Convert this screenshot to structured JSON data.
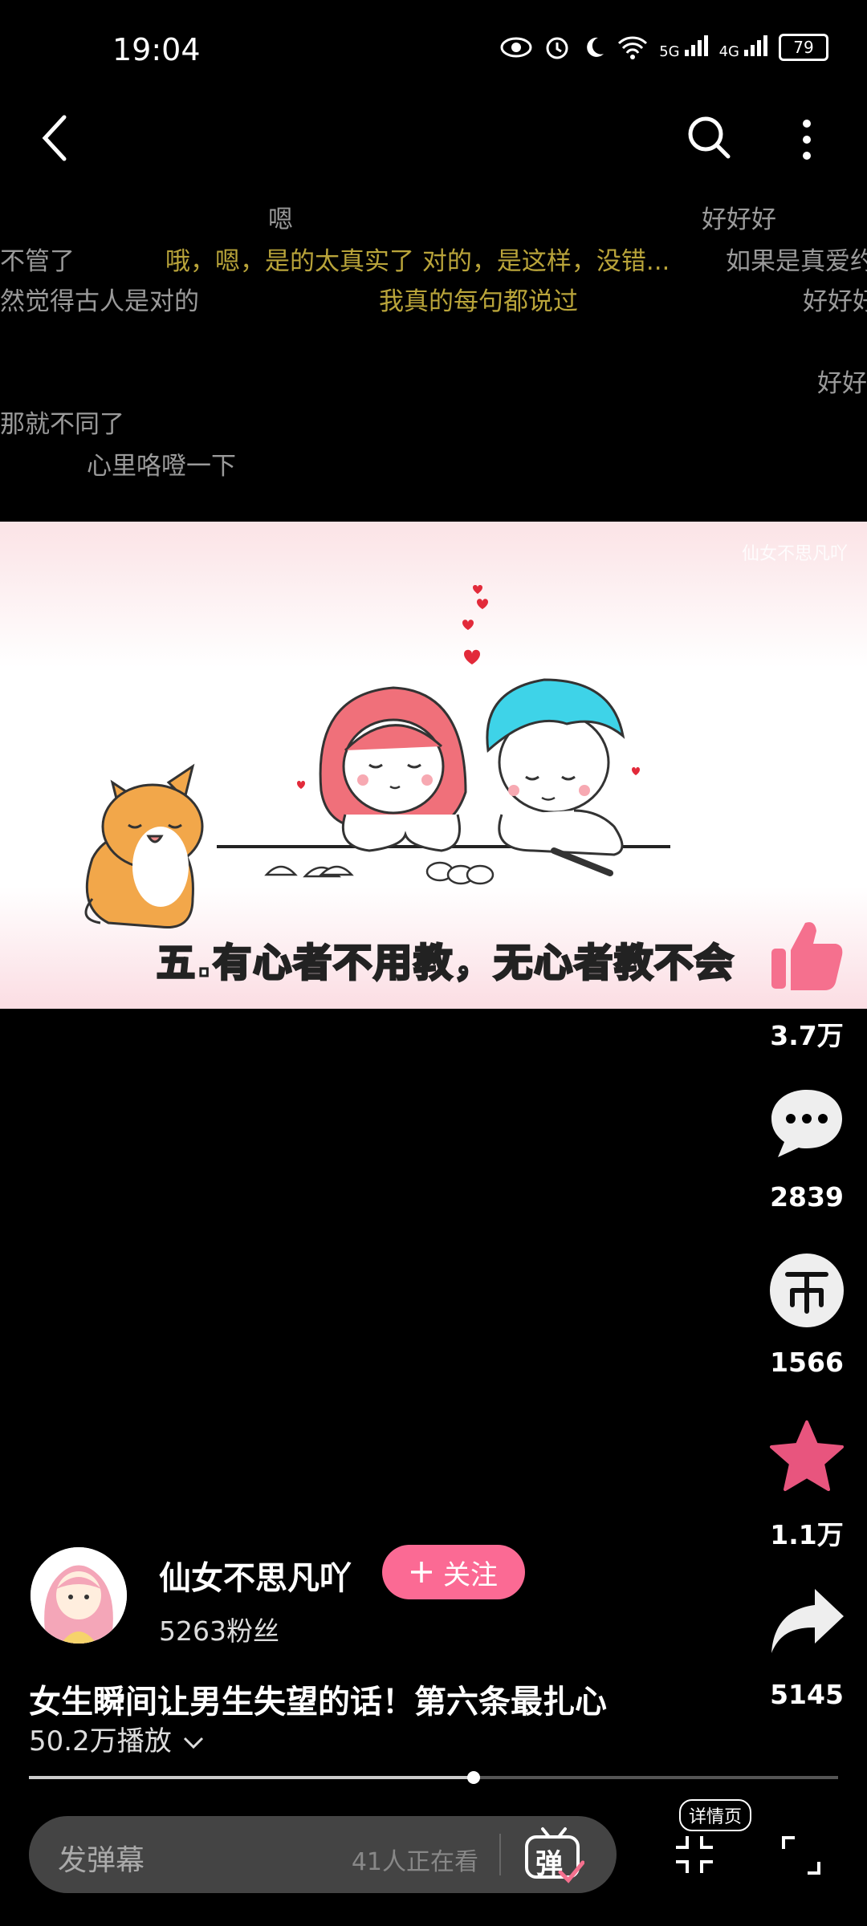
{
  "status_bar": {
    "time": "19:04",
    "battery": "79",
    "net1": "5G",
    "net2": "4G"
  },
  "danmaku": [
    {
      "text": "嗯",
      "color": "grey"
    },
    {
      "text": "好好好",
      "color": "grey"
    },
    {
      "text": "不管了",
      "color": "grey"
    },
    {
      "text": "哦，嗯，是的太真实了 对的，是这样，没错...",
      "color": "gold"
    },
    {
      "text": "如果是真爱约",
      "color": "grey"
    },
    {
      "text": "然觉得古人是对的",
      "color": "grey"
    },
    {
      "text": "我真的每句都说过",
      "color": "gold"
    },
    {
      "text": "好好好",
      "color": "grey"
    },
    {
      "text": "好好",
      "color": "grey"
    },
    {
      "text": "那就不同了",
      "color": "grey"
    },
    {
      "text": "心里咯噔一下",
      "color": "grey"
    }
  ],
  "video": {
    "watermark": "仙女不思凡吖",
    "subtitle": "五.有心者不用教，无心者教不会"
  },
  "actions": {
    "like_count": "3.7万",
    "comment_count": "2839",
    "coin_count": "1566",
    "favorite_count": "1.1万",
    "share_count": "5145"
  },
  "author": {
    "name": "仙女不思凡吖",
    "follow_label": "关注",
    "fans": "5263粉丝"
  },
  "video_info": {
    "title": "女生瞬间让男生失望的话！第六条最扎心",
    "plays": "50.2万播放",
    "progress_fraction": 0.55
  },
  "bottom_bar": {
    "danmaku_placeholder": "发弹幕",
    "watching": "41人正在看",
    "danmaku_button": "弹",
    "detail_label": "详情页"
  },
  "colors": {
    "accent_pink": "#fb6a94",
    "like_pink": "#f5708e",
    "danmaku_gold": "#b9a43a"
  }
}
